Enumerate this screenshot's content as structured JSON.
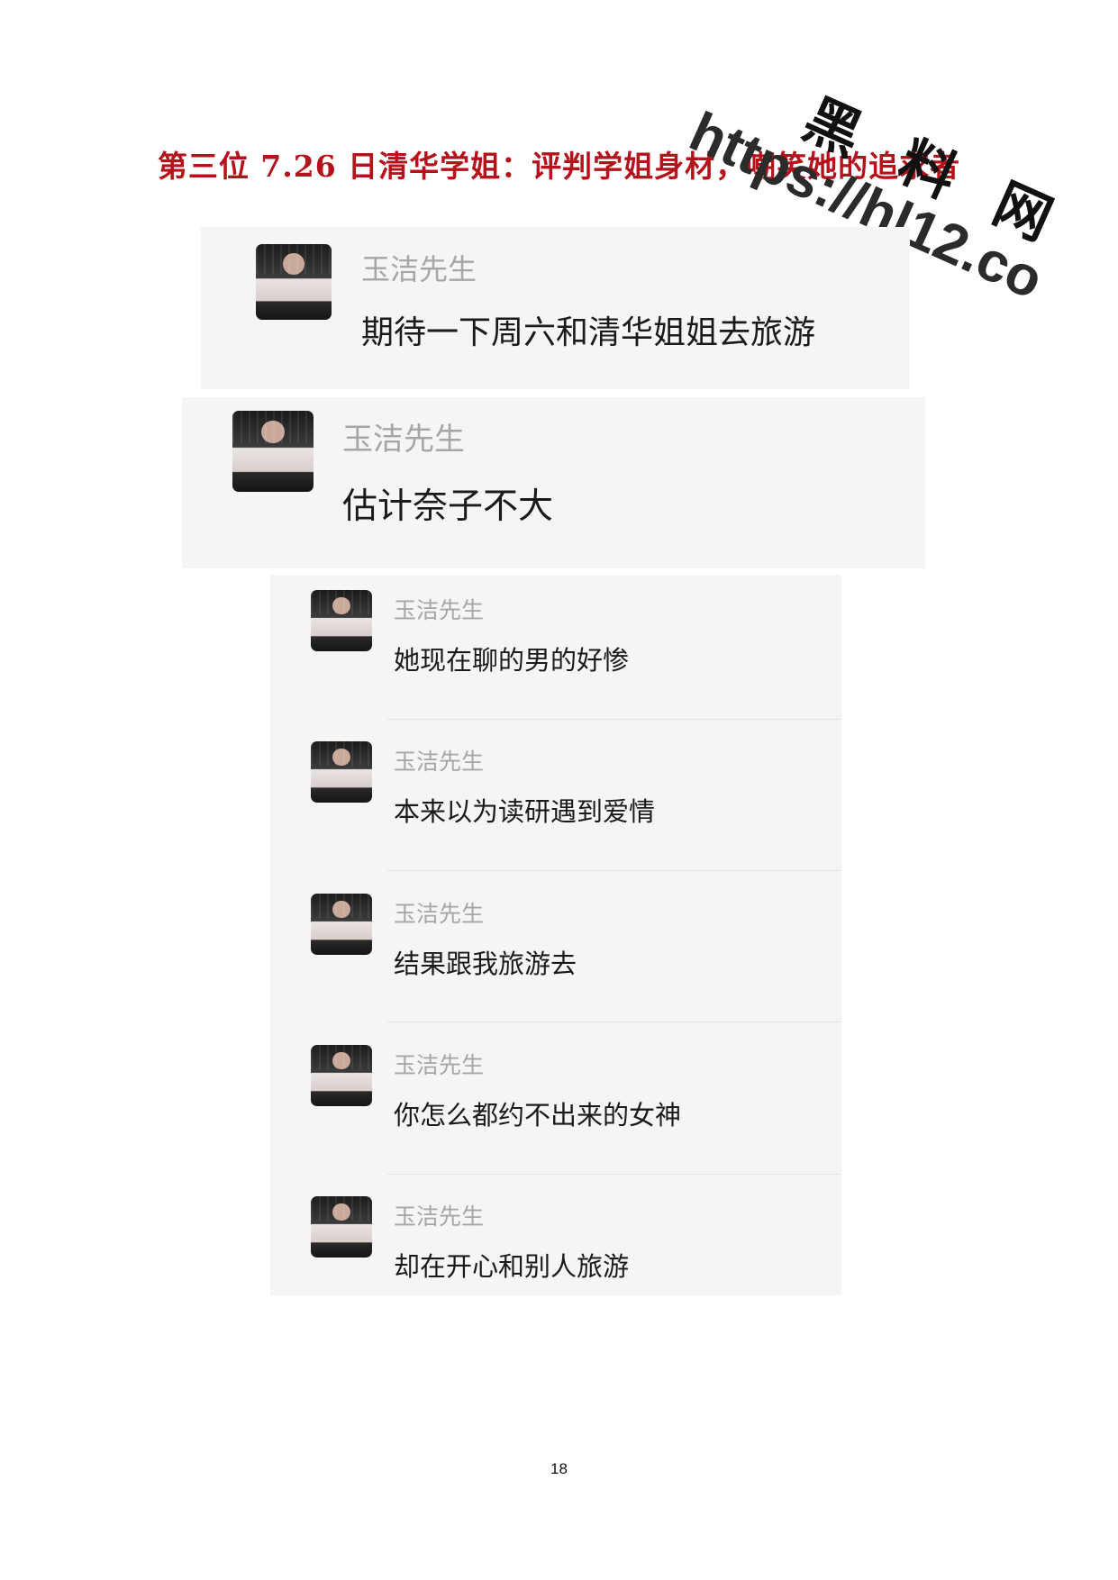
{
  "title": "第三位 7.26 日清华学姐：评判学姐身材，嘲笑她的追求者",
  "watermark": {
    "brand": "黑 料 网",
    "url": "https://hl12.co"
  },
  "page_number": "18",
  "chats": [
    {
      "sender": "玉洁先生",
      "text": "期待一下周六和清华姐姐去旅游"
    },
    {
      "sender": "玉洁先生",
      "text": "估计奈子不大"
    },
    {
      "sender": "玉洁先生",
      "text": "她现在聊的男的好惨"
    },
    {
      "sender": "玉洁先生",
      "text": "本来以为读研遇到爱情"
    },
    {
      "sender": "玉洁先生",
      "text": "结果跟我旅游去"
    },
    {
      "sender": "玉洁先生",
      "text": "你怎么都约不出来的女神"
    },
    {
      "sender": "玉洁先生",
      "text": "却在开心和别人旅游"
    }
  ]
}
